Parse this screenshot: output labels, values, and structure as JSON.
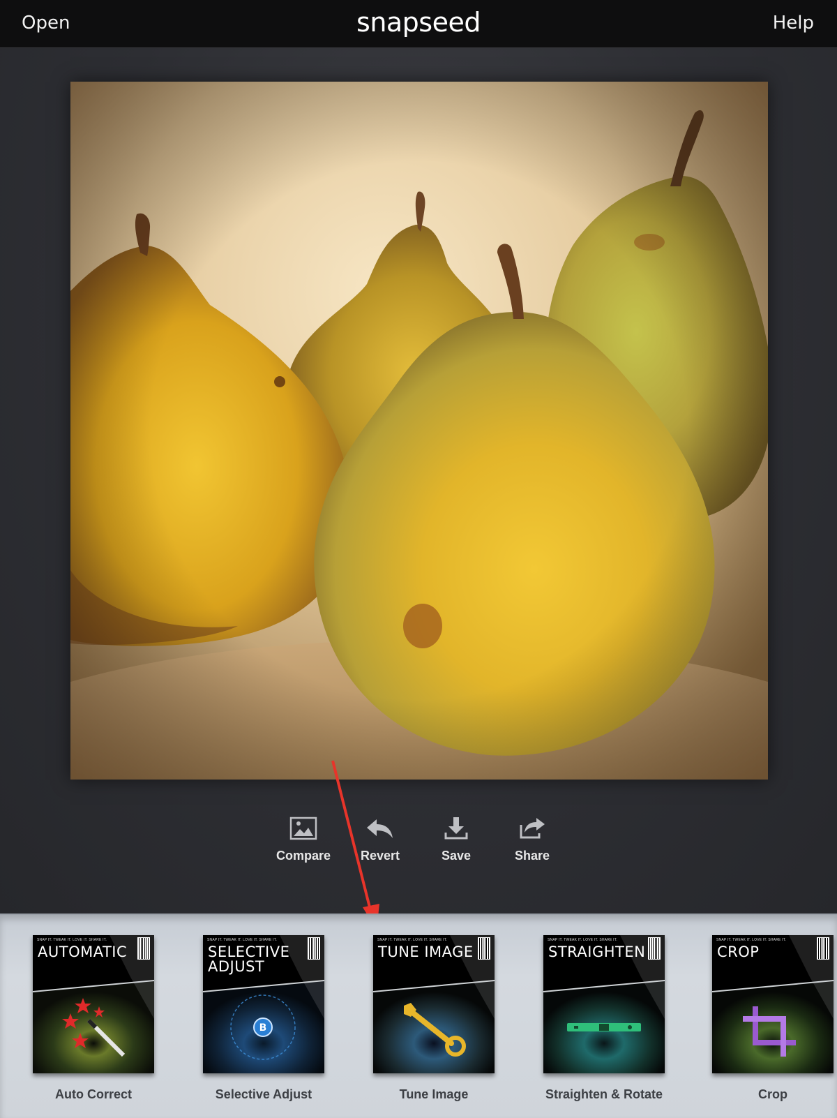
{
  "topbar": {
    "open_label": "Open",
    "app_title": "snapseed",
    "help_label": "Help"
  },
  "photo": {
    "subject": "three yellow-green pears on a textured cream background"
  },
  "actions": [
    {
      "label": "Compare",
      "icon": "image-icon"
    },
    {
      "label": "Revert",
      "icon": "undo-arrow-icon"
    },
    {
      "label": "Save",
      "icon": "download-icon"
    },
    {
      "label": "Share",
      "icon": "share-arrow-icon"
    }
  ],
  "tools": [
    {
      "card_title": "AUTOMATIC",
      "name": "Auto Correct",
      "icon": "magic-wand-icon"
    },
    {
      "card_title": "SELECTIVE ADJUST",
      "name": "Selective Adjust",
      "icon": "control-point-icon"
    },
    {
      "card_title": "TUNE IMAGE",
      "name": "Tune Image",
      "icon": "wrench-icon"
    },
    {
      "card_title": "STRAIGHTEN",
      "name": "Straighten & Rotate",
      "icon": "spirit-level-icon"
    },
    {
      "card_title": "CROP",
      "name": "Crop",
      "icon": "crop-icon"
    }
  ],
  "card_tagline": "SNAP IT. TWEAK IT. LOVE IT. SHARE IT.",
  "annotation_color": "#e8342a"
}
